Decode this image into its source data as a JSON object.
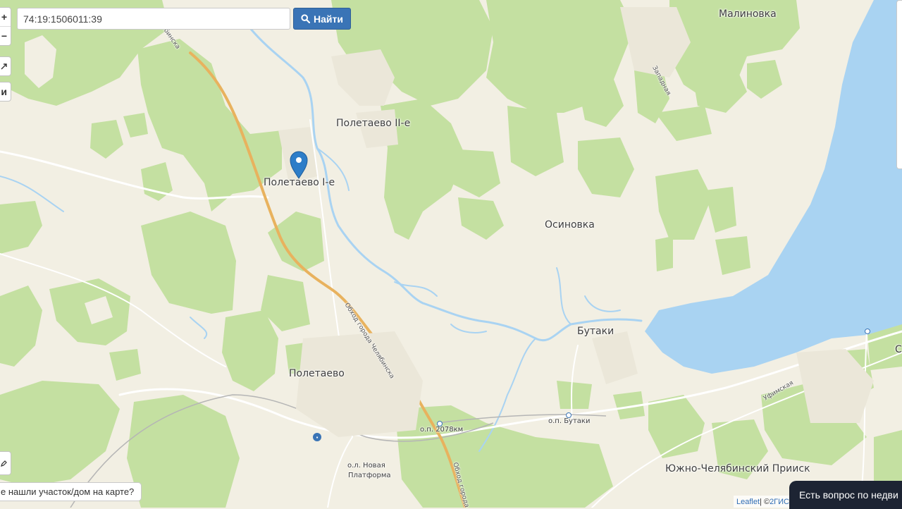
{
  "search": {
    "value": "74:19:1506011:39",
    "placeholder": "",
    "button_label": "Найти",
    "button_icon": "search-icon"
  },
  "map_controls": {
    "zoom_in": "+",
    "zoom_out": "−",
    "fullscreen_icon": "expand-icon",
    "layers_glyph": "и",
    "draw_icon": "pencil-icon"
  },
  "places": {
    "malinovka": "Малиновка",
    "poletaevo2": "Полетаево II-е",
    "poletaevo1": "Полетаево I-е",
    "osinovka": "Осиновка",
    "butaki": "Бутаки",
    "poletaevo": "Полетаево",
    "yuzhno": "Южно-Челябинский Прииск",
    "edge_s": "С"
  },
  "stops": {
    "op2078": "о.п. 2078км",
    "butaki_stop": "о.п. Бутаки",
    "novaya1": "о.л. Новая",
    "novaya2": "Платформа"
  },
  "streets": {
    "chelyabinska_top": "Челябинска",
    "obhod": "Обход города Челябинска",
    "obhod_bottom": "Обход города",
    "zapadnaya": "Западная",
    "ufimskaya": "Уфимская"
  },
  "marker_icon": "map-pin-icon",
  "not_found_text": "е нашли участок/дом на карте?",
  "attribution": {
    "leaflet": "Leaflet",
    "separator": " | © ",
    "provider": "2ГИС"
  },
  "chat_text": "Есть вопрос по недви",
  "colors": {
    "land": "#f2efe3",
    "forest": "#c4e0a1",
    "water": "#a9d3f2",
    "highway": "#e8b25e",
    "marker": "#2d7dc8",
    "button": "#3a74b6",
    "chat": "#1d2433"
  }
}
